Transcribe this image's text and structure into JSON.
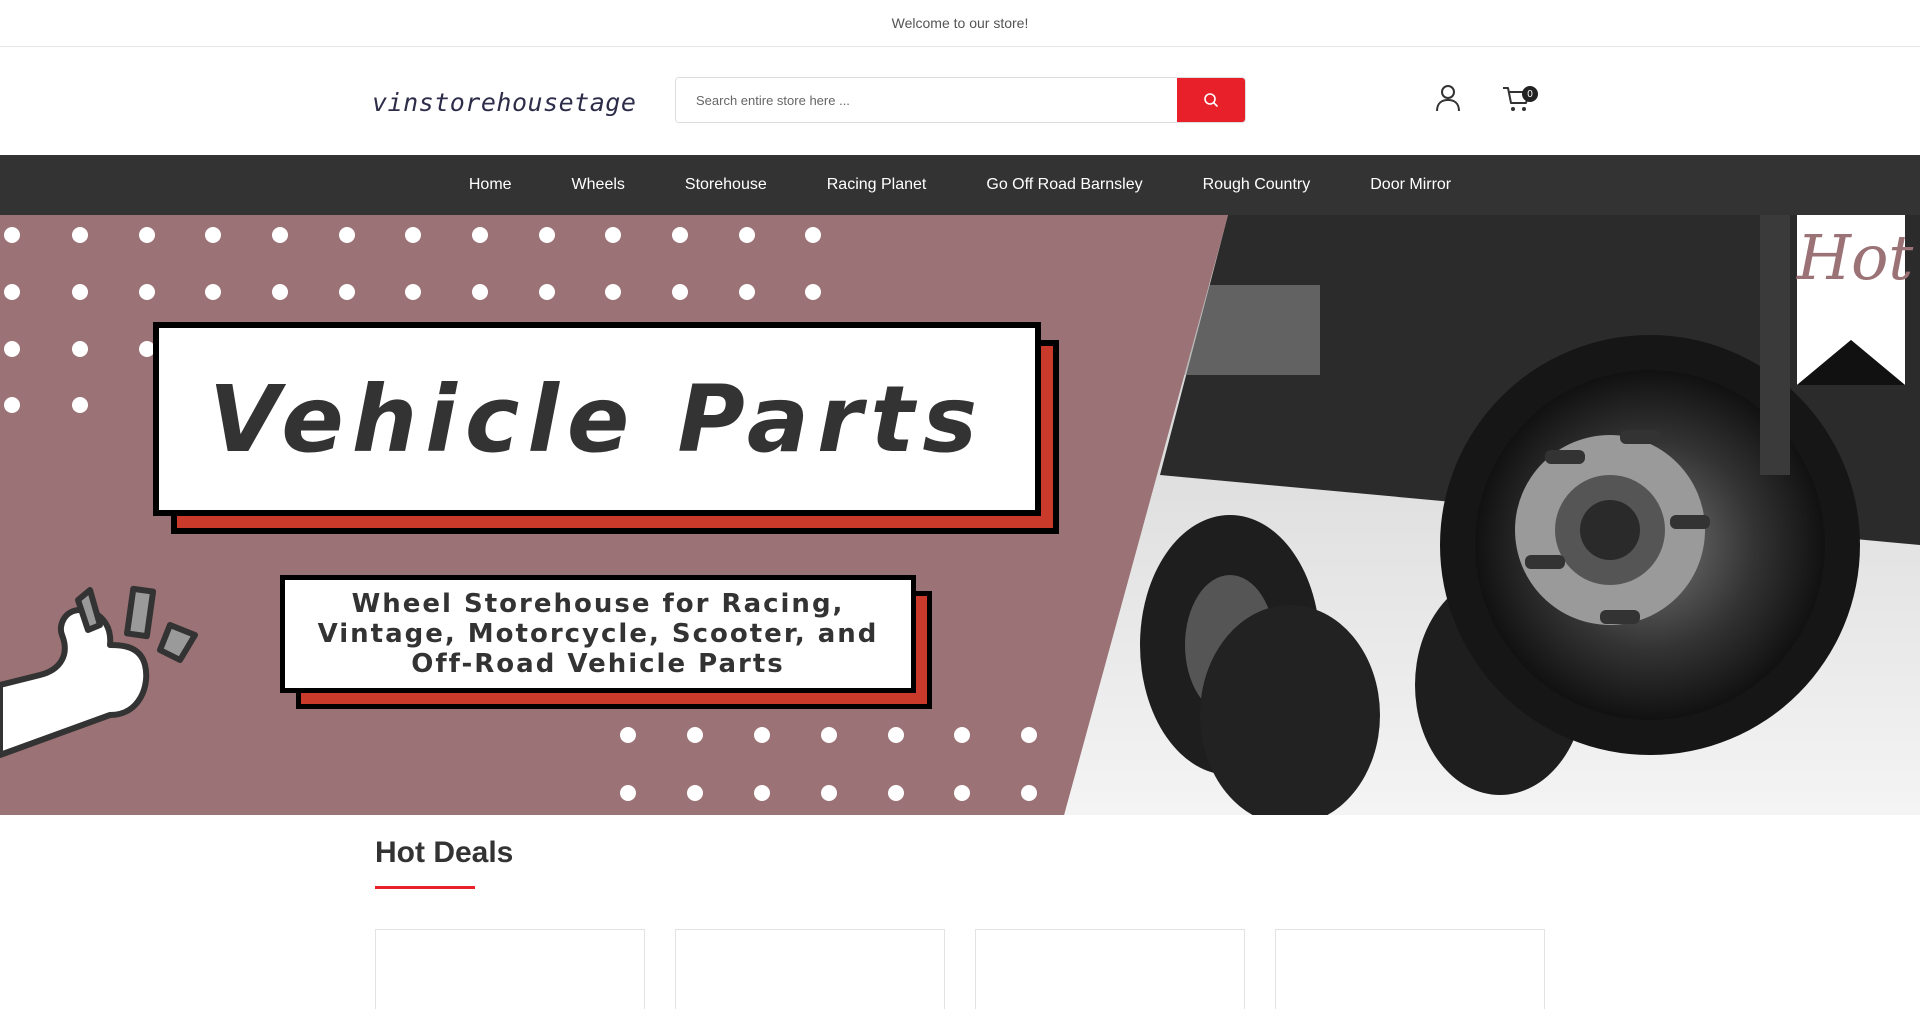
{
  "topbar": {
    "welcome": "Welcome to our store!"
  },
  "header": {
    "logo_text": "vinstorehousetage",
    "search_placeholder": "Search entire store here ...",
    "cart_count": "0"
  },
  "nav": {
    "items": [
      {
        "label": "Home"
      },
      {
        "label": "Wheels"
      },
      {
        "label": "Storehouse"
      },
      {
        "label": "Racing Planet"
      },
      {
        "label": "Go Off Road Barnsley"
      },
      {
        "label": "Rough Country"
      },
      {
        "label": "Door Mirror"
      }
    ]
  },
  "hero": {
    "title": "Vehicle Parts",
    "subtitle": "Wheel Storehouse for Racing, Vintage, Motorcycle, Scooter, and Off-Road Vehicle Parts",
    "ribbon_text": "Hot"
  },
  "section": {
    "title": "Hot Deals"
  },
  "colors": {
    "accent": "#e8202a",
    "nav_bg": "#333333",
    "hero_bg": "#9b7275",
    "frame_red": "#c93a2a"
  },
  "icons": {
    "search": "search-icon",
    "user": "user-icon",
    "cart": "cart-icon"
  }
}
